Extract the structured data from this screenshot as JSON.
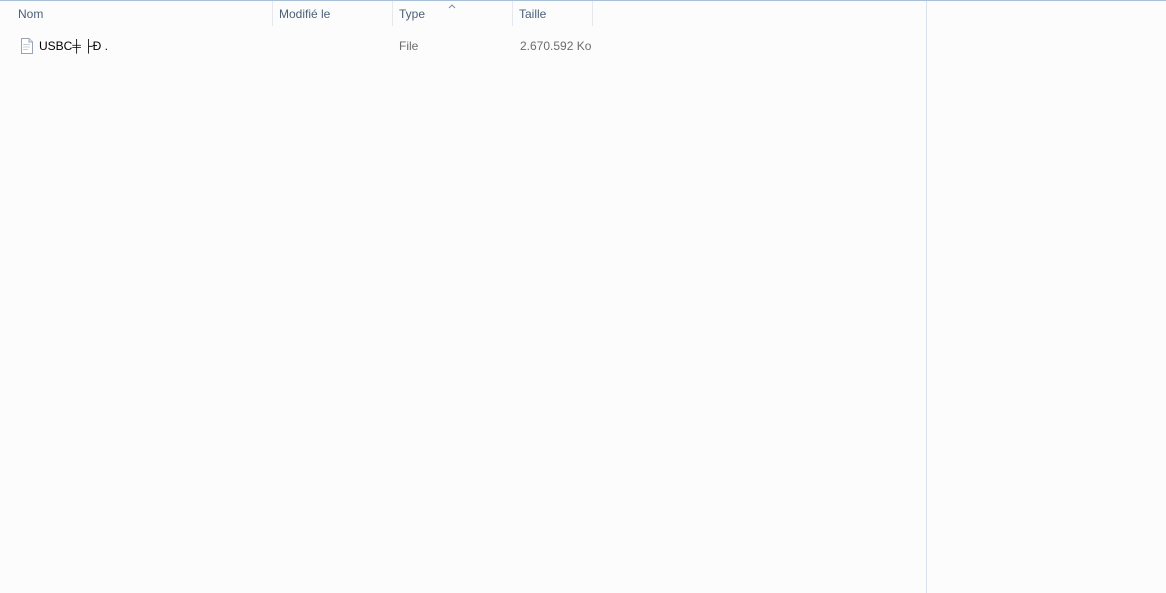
{
  "columns": {
    "name": "Nom",
    "modified": "Modifié le",
    "type": "Type",
    "size": "Taille"
  },
  "sort": {
    "column": "Type",
    "direction": "ascending",
    "icon": "chevron-up-icon"
  },
  "files": [
    {
      "icon": "file-icon",
      "name": "USBC╪ ├Ð .",
      "modified": "",
      "type": "File",
      "size": "2.670.592 Ko"
    }
  ],
  "colors": {
    "header_text": "#4c607a",
    "secondary_text": "#6d6d6d",
    "top_border": "#a7bfd9",
    "divider": "#d8e1ec"
  }
}
